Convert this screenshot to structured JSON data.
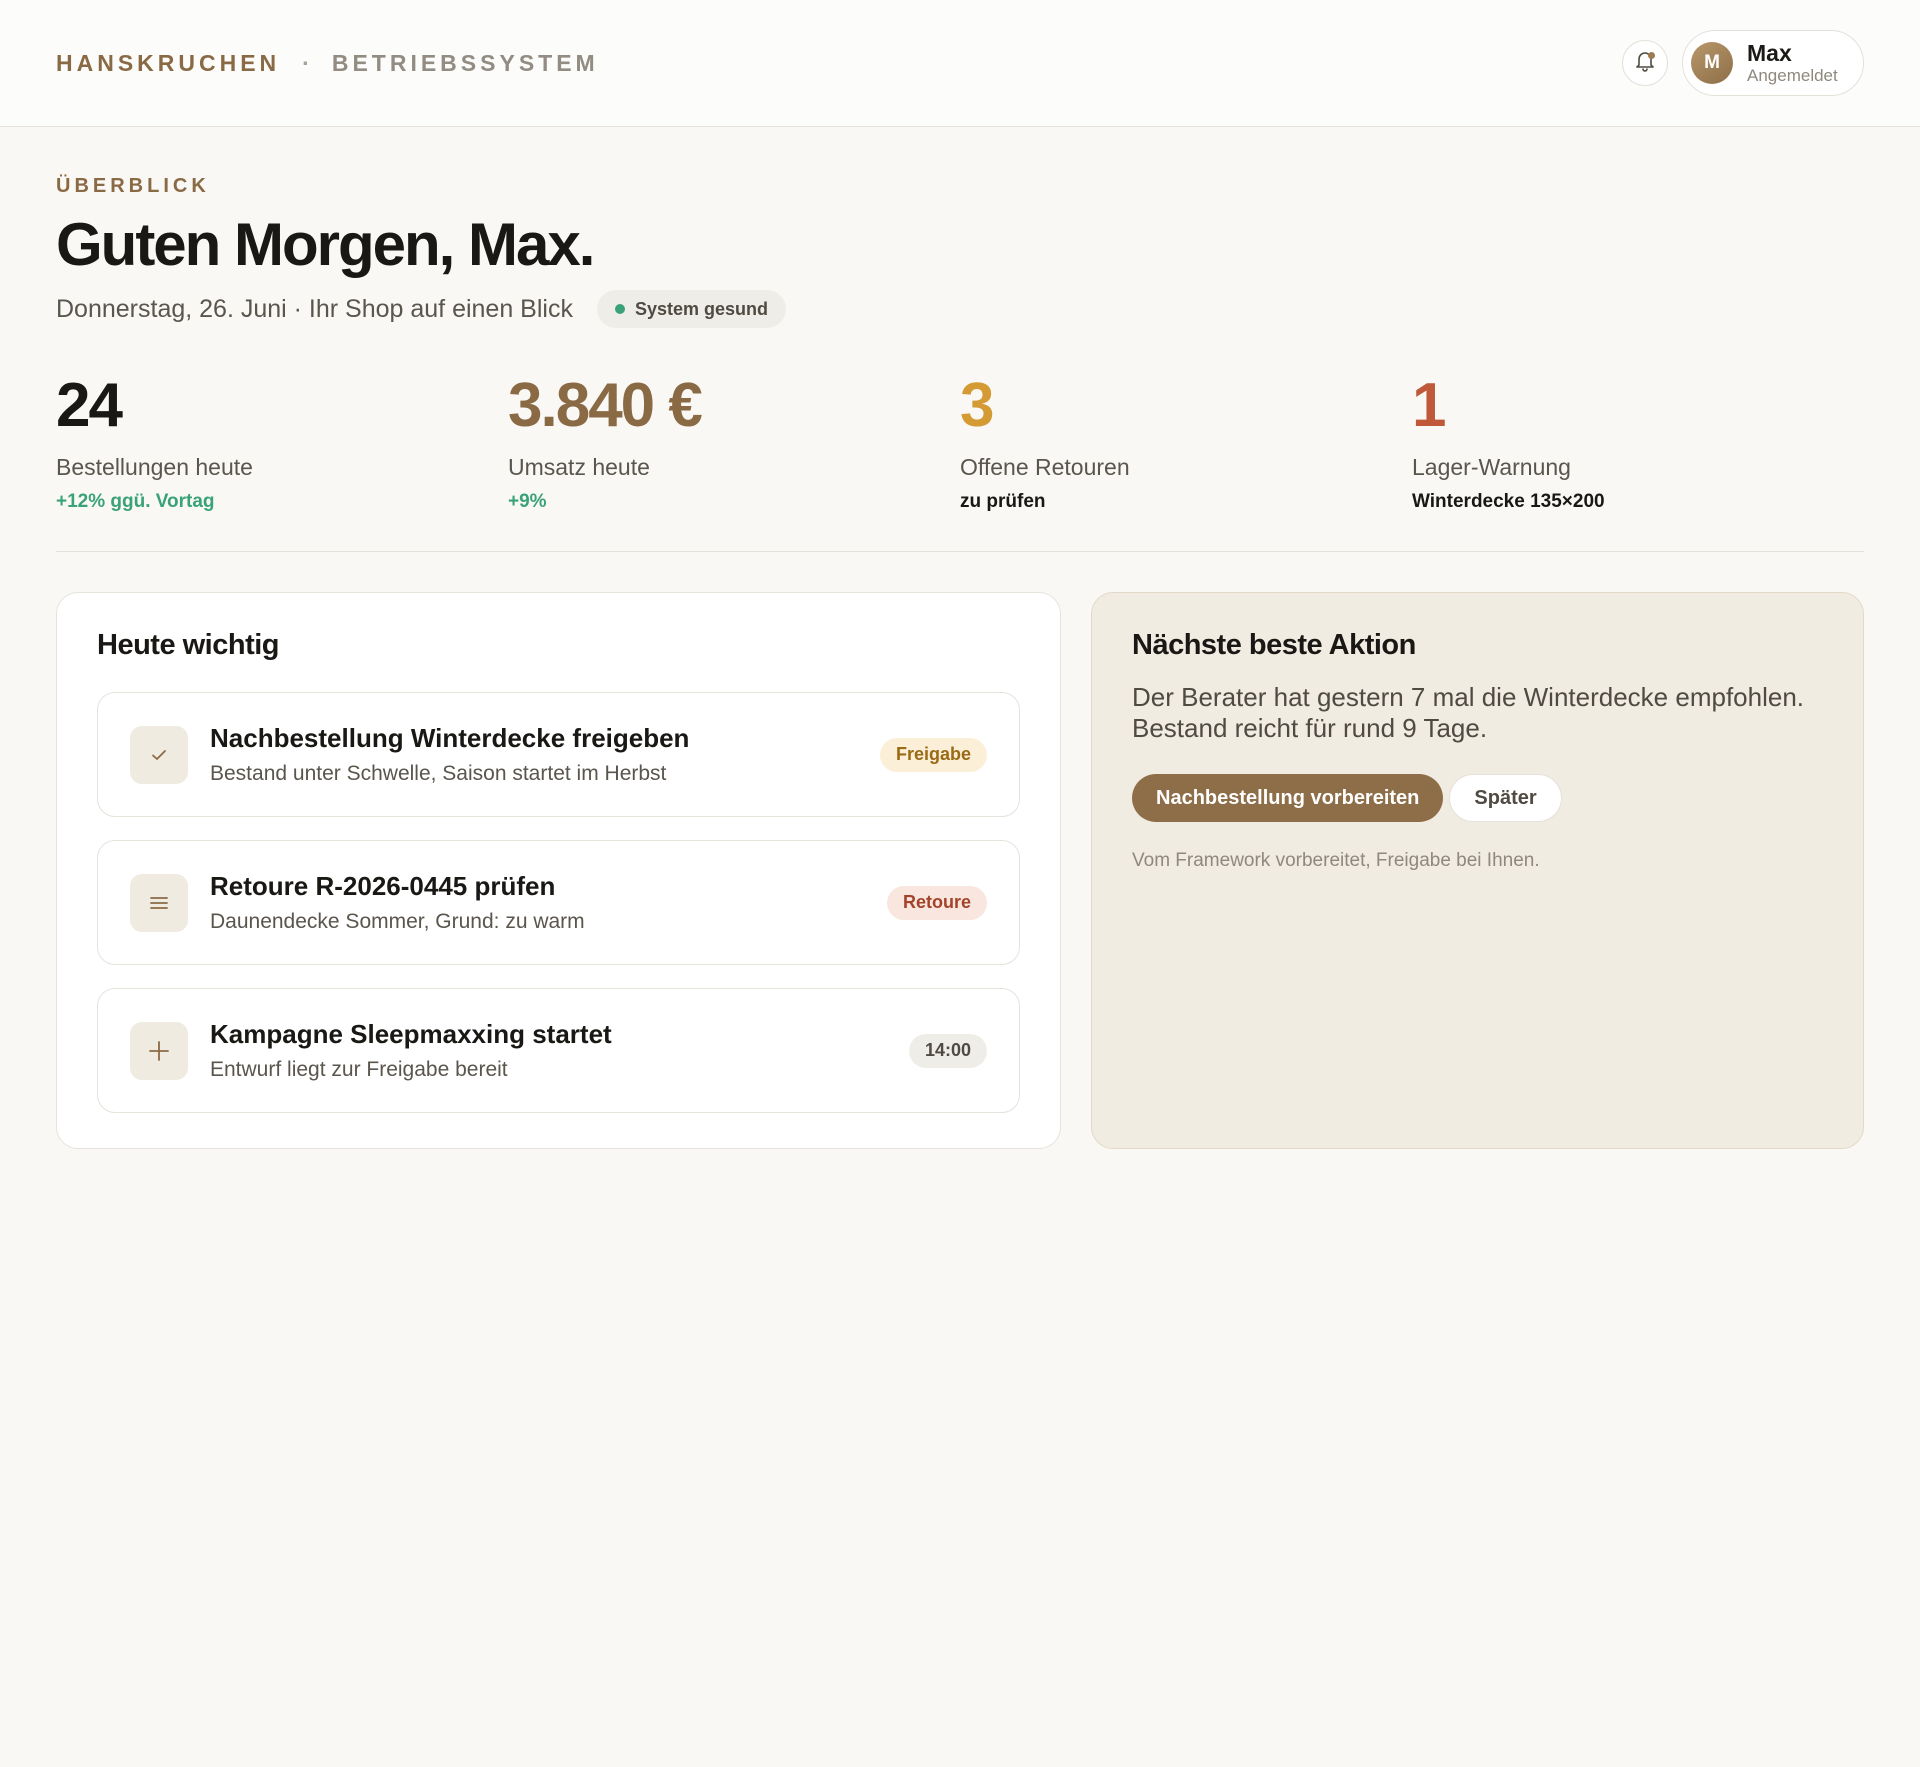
{
  "header": {
    "brand": "HANSKRUCHEN",
    "separator": "·",
    "system": "BETRIEBSSYSTEM",
    "user": {
      "initial": "M",
      "name": "Max",
      "status": "Angemeldet"
    }
  },
  "overview": {
    "eyebrow": "ÜBERBLICK",
    "greeting": "Guten Morgen, Max.",
    "date_line": "Donnerstag, 26. Juni · Ihr Shop auf einen Blick",
    "health": "System gesund"
  },
  "stats": [
    {
      "value": "24",
      "label": "Bestellungen heute",
      "note": "+12% ggü. Vortag",
      "value_color": "#1a1815",
      "note_color": "#3aa278"
    },
    {
      "value": "3.840 €",
      "label": "Umsatz heute",
      "note": "+9%",
      "value_color": "#8a6a45",
      "note_color": "#3aa278"
    },
    {
      "value": "3",
      "label": "Offene Retouren",
      "note": "zu prüfen",
      "value_color": "#d49a34",
      "note_color": "#1a1815"
    },
    {
      "value": "1",
      "label": "Lager-Warnung",
      "note": "Winterdecke 135×200",
      "value_color": "#c0583a",
      "note_color": "#1a1815"
    }
  ],
  "today": {
    "title": "Heute wichtig",
    "tasks": [
      {
        "icon": "check-icon",
        "title": "Nachbestellung Winterdecke freigeben",
        "subtitle": "Bestand unter Schwelle, Saison startet im Herbst",
        "badge": "Freigabe",
        "badge_bg": "#fbf0d7",
        "badge_color": "#9a6a16"
      },
      {
        "icon": "list-icon",
        "title": "Retoure R-2026-0445 prüfen",
        "subtitle": "Daunendecke Sommer, Grund: zu warm",
        "badge": "Retoure",
        "badge_bg": "#f8e6df",
        "badge_color": "#a3432a"
      },
      {
        "icon": "plus-icon",
        "title": "Kampagne Sleepmaxxing startet",
        "subtitle": "Entwurf liegt zur Freigabe bereit",
        "badge": "14:00",
        "badge_bg": "#efede7",
        "badge_color": "#4f4a42"
      }
    ]
  },
  "next_action": {
    "title": "Nächste beste Aktion",
    "text": "Der Berater hat gestern 7 mal die Winterdecke empfohlen. Bestand reicht für rund 9 Tage.",
    "primary_label": "Nachbestellung vorbereiten",
    "secondary_label": "Später",
    "footnote": "Vom Framework vorbereitet, Freigabe bei Ihnen."
  },
  "colors": {
    "accent": "#8e6e48",
    "background": "#f9f8f5",
    "success": "#3aa278"
  }
}
